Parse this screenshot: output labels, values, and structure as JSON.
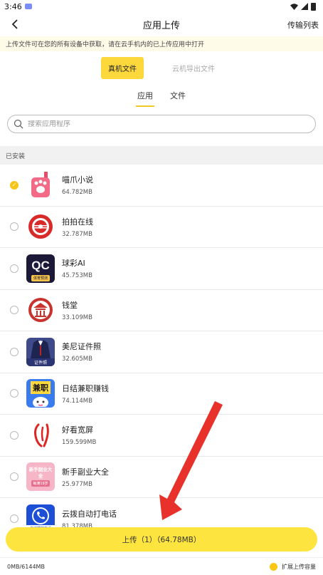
{
  "status_bar": {
    "time": "3:46"
  },
  "nav": {
    "title": "应用上传",
    "right_link": "传输列表"
  },
  "notice": "上传文件可在您的所有设备中获取，请在云手机内的已上传应用中打开",
  "main_tabs": [
    {
      "label": "真机文件",
      "active": true
    },
    {
      "label": "云机导出文件",
      "active": false
    }
  ],
  "sub_tabs": [
    {
      "label": "应用",
      "active": true
    },
    {
      "label": "文件",
      "active": false
    }
  ],
  "search": {
    "placeholder": "搜索应用程序"
  },
  "section_label": "已安装",
  "apps": [
    {
      "name": "喵爪小说",
      "size": "64.782MB",
      "checked": true,
      "icon": "paw-icon"
    },
    {
      "name": "拍拍在线",
      "size": "32.787MB",
      "checked": false,
      "icon": "target-icon"
    },
    {
      "name": "球彩AI",
      "size": "45.753MB",
      "checked": false,
      "icon": "qc-icon",
      "icon_text": "QC",
      "icon_sub": "体育预测"
    },
    {
      "name": "钱堂",
      "size": "33.109MB",
      "checked": false,
      "icon": "temple-icon"
    },
    {
      "name": "美尼证件照",
      "size": "32.605MB",
      "checked": false,
      "icon": "suit-icon",
      "icon_sub": "证件照"
    },
    {
      "name": "日结兼职赚钱",
      "size": "74.114MB",
      "checked": false,
      "icon": "jianzhi-icon",
      "icon_text": "兼职"
    },
    {
      "name": "好看宽屏",
      "size": "159.599MB",
      "checked": false,
      "icon": "brush-icon"
    },
    {
      "name": "新手副业大全",
      "size": "25.977MB",
      "checked": false,
      "icon": "fuye-icon",
      "icon_text": "新手副业大全",
      "icon_sub": "每满19岁"
    },
    {
      "name": "云拨自动打电话",
      "size": "81.378MB",
      "checked": false,
      "icon": "phone-icon",
      "icon_sub": "自动拨打电话"
    }
  ],
  "upload_button": "上传（1）（64.78MB）",
  "footer": {
    "quota": "0MB/6144MB",
    "expand_label": "扩展上传容量"
  },
  "colors": {
    "accent": "#fcd83c",
    "button": "#fde43f",
    "arrow": "#e8312a",
    "notice_bg": "#fffbe9"
  }
}
